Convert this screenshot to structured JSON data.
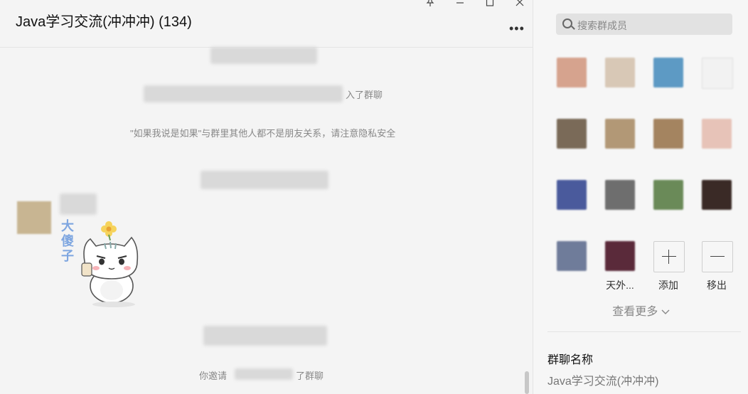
{
  "chat": {
    "title": "Java学习交流(冲冲冲) (134)",
    "more_label": "•••",
    "system_messages": {
      "joined_suffix": "入了群聊",
      "notice": "\"如果我说是如果\"与群里其他人都不是朋友关系，请注意隐私安全",
      "invite_prefix": "你邀请",
      "invite_suffix": "了群聊"
    },
    "sticker_text": "大傻子"
  },
  "window_controls": {
    "pin_icon": "pin-icon",
    "minimize_icon": "minimize-icon",
    "maximize_icon": "maximize-icon",
    "close_icon": "close-icon"
  },
  "panel": {
    "search_placeholder": "搜索群成员",
    "members_row1": [
      "",
      "",
      "",
      ""
    ],
    "members_row2": [
      "",
      "",
      "",
      ""
    ],
    "members_row3": [
      "",
      "",
      "",
      ""
    ],
    "member_row4_names": [
      "",
      "天外..."
    ],
    "add_label": "添加",
    "remove_label": "移出",
    "see_more": "查看更多",
    "group_name_label": "群聊名称",
    "group_name_value": "Java学习交流(冲冲冲)"
  },
  "colors": {
    "background": "#f4f4f4",
    "panel": "#f6f6f6",
    "search_bg": "#e2e2e2",
    "muted_text": "#888888",
    "sticker_text": "#7ea6e0"
  }
}
